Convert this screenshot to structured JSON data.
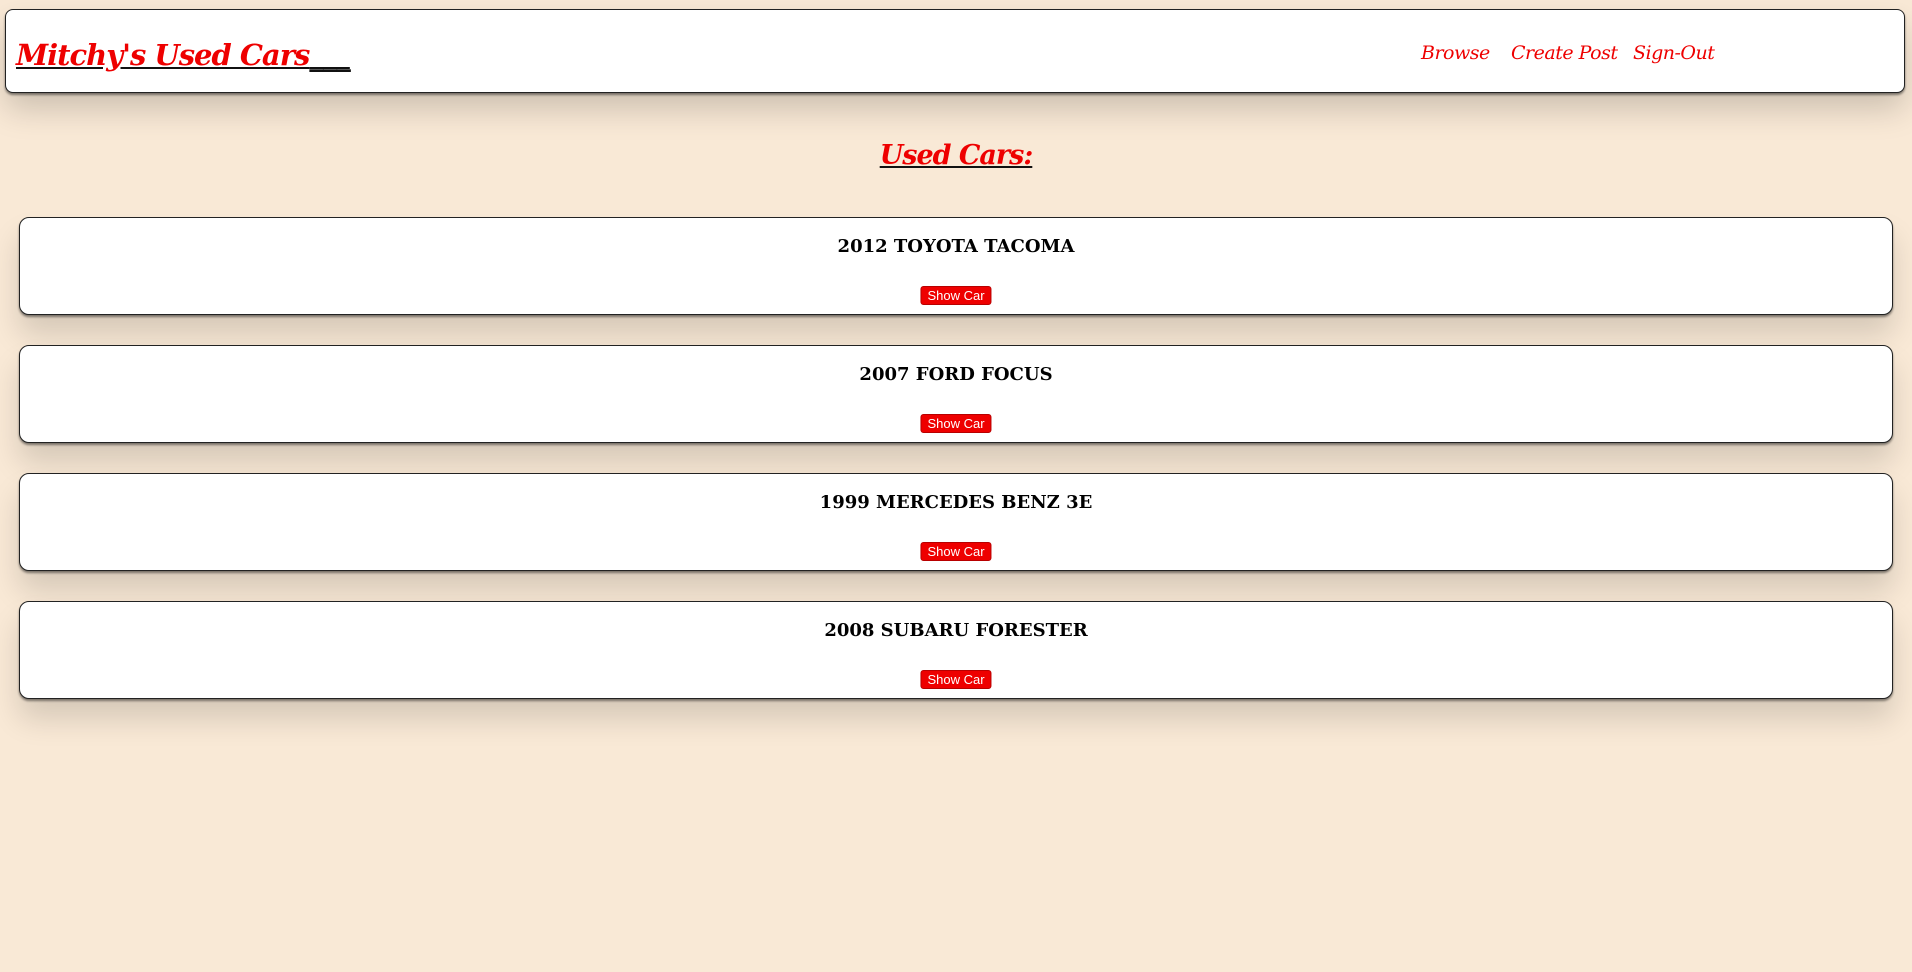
{
  "header": {
    "brand": "Mitchy's Used Cars",
    "brand_trail": "___",
    "nav": [
      {
        "label": "Browse"
      },
      {
        "label": "Create Post"
      },
      {
        "label": "Sign-Out"
      }
    ]
  },
  "main": {
    "heading": "Used Cars:",
    "cars": [
      {
        "title": "2012 TOYOTA TACOMA",
        "button": "Show Car"
      },
      {
        "title": "2007 FORD FOCUS",
        "button": "Show Car"
      },
      {
        "title": "1999 MERCEDES BENZ 3E",
        "button": "Show Car"
      },
      {
        "title": "2008 SUBARU FORESTER",
        "button": "Show Car"
      }
    ]
  },
  "colors": {
    "background": "#f9e9d6",
    "accent": "#ee0000",
    "card": "#ffffff"
  }
}
